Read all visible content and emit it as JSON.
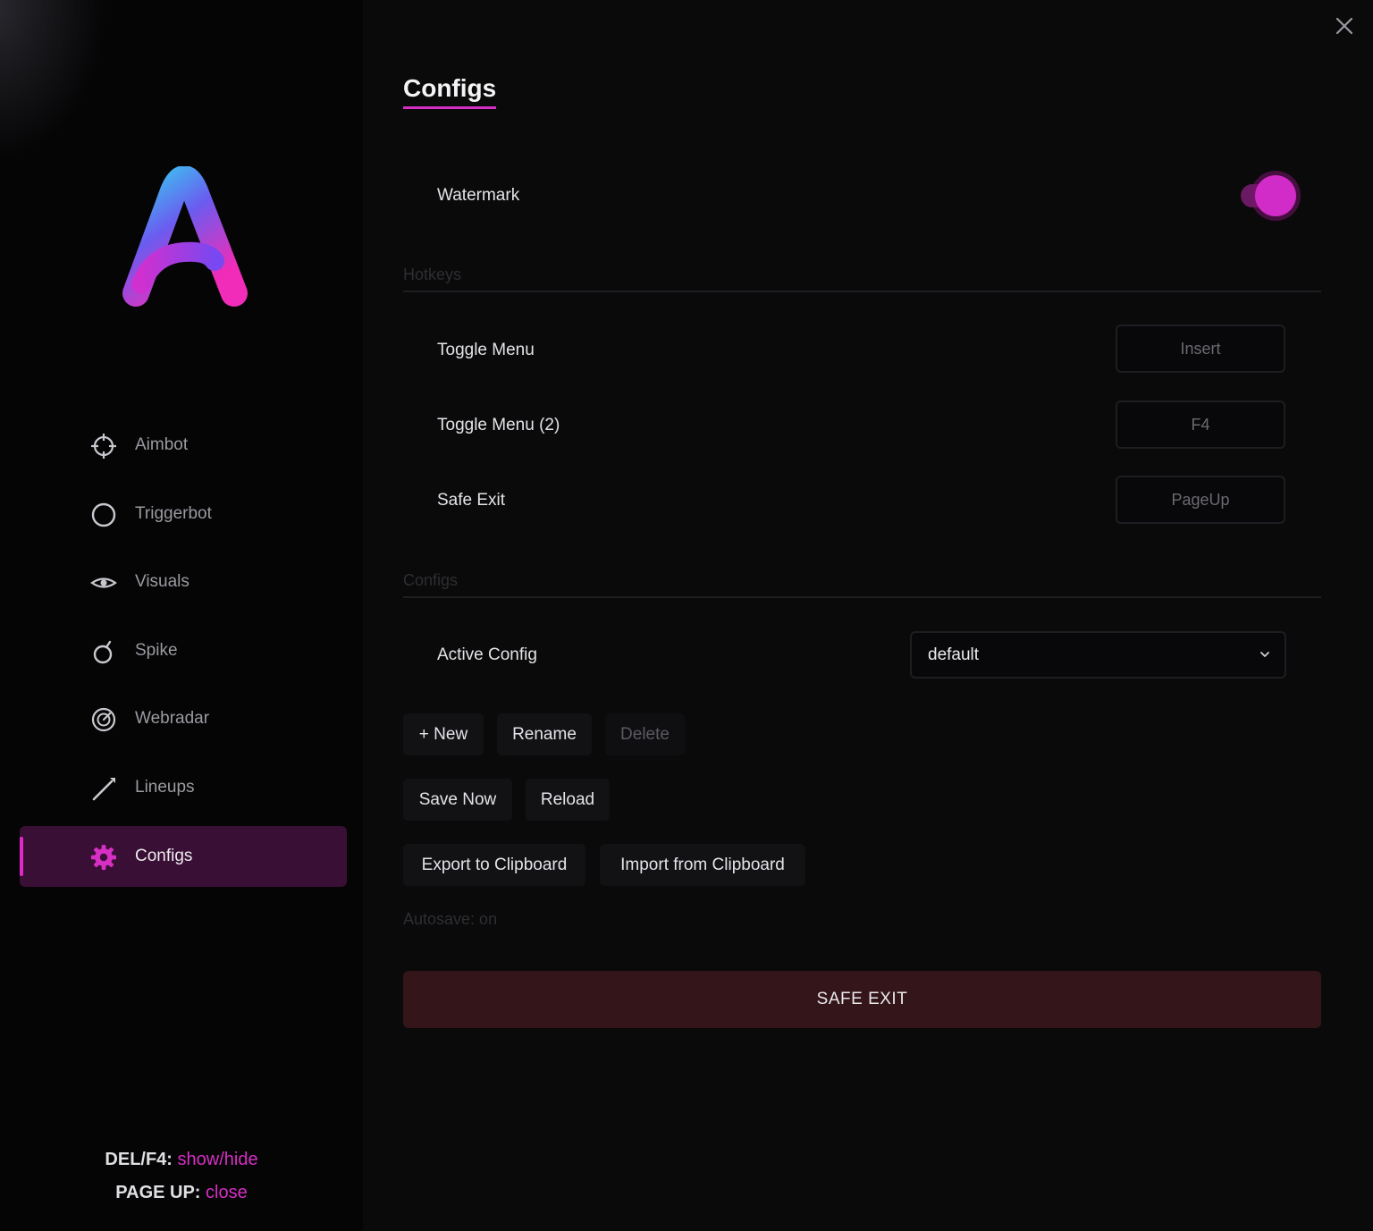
{
  "colors": {
    "accent": "#d62fc4",
    "active_bg": "#3a0f35",
    "danger_bg": "#341519"
  },
  "sidebar": {
    "logo_icon": "letter-a-gradient-logo",
    "items": [
      {
        "label": "Aimbot",
        "icon": "crosshair-icon"
      },
      {
        "label": "Triggerbot",
        "icon": "circle-icon"
      },
      {
        "label": "Visuals",
        "icon": "eye-icon"
      },
      {
        "label": "Spike",
        "icon": "bomb-icon"
      },
      {
        "label": "Webradar",
        "icon": "radar-icon"
      },
      {
        "label": "Lineups",
        "icon": "pen-icon"
      },
      {
        "label": "Configs",
        "icon": "gear-icon",
        "active": true
      }
    ],
    "footer": {
      "line1_key": "DEL/F4:",
      "line1_action": "show/hide",
      "line2_key": "PAGE UP:",
      "line2_action": "close"
    }
  },
  "header": {
    "title": "Configs",
    "close_icon": "close-icon"
  },
  "watermark": {
    "label": "Watermark",
    "enabled": true
  },
  "hotkeys": {
    "section": "Hotkeys",
    "rows": [
      {
        "label": "Toggle Menu",
        "key": "Insert"
      },
      {
        "label": "Toggle Menu (2)",
        "key": "F4"
      },
      {
        "label": "Safe Exit",
        "key": "PageUp"
      }
    ]
  },
  "configs": {
    "section": "Configs",
    "active_label": "Active Config",
    "active_value": "default",
    "buttons": {
      "new": "+ New",
      "rename": "Rename",
      "delete": "Delete",
      "save_now": "Save Now",
      "reload": "Reload",
      "export": "Export to Clipboard",
      "import": "Import from Clipboard"
    },
    "autosave": "Autosave: on"
  },
  "safe_exit": "SAFE EXIT"
}
